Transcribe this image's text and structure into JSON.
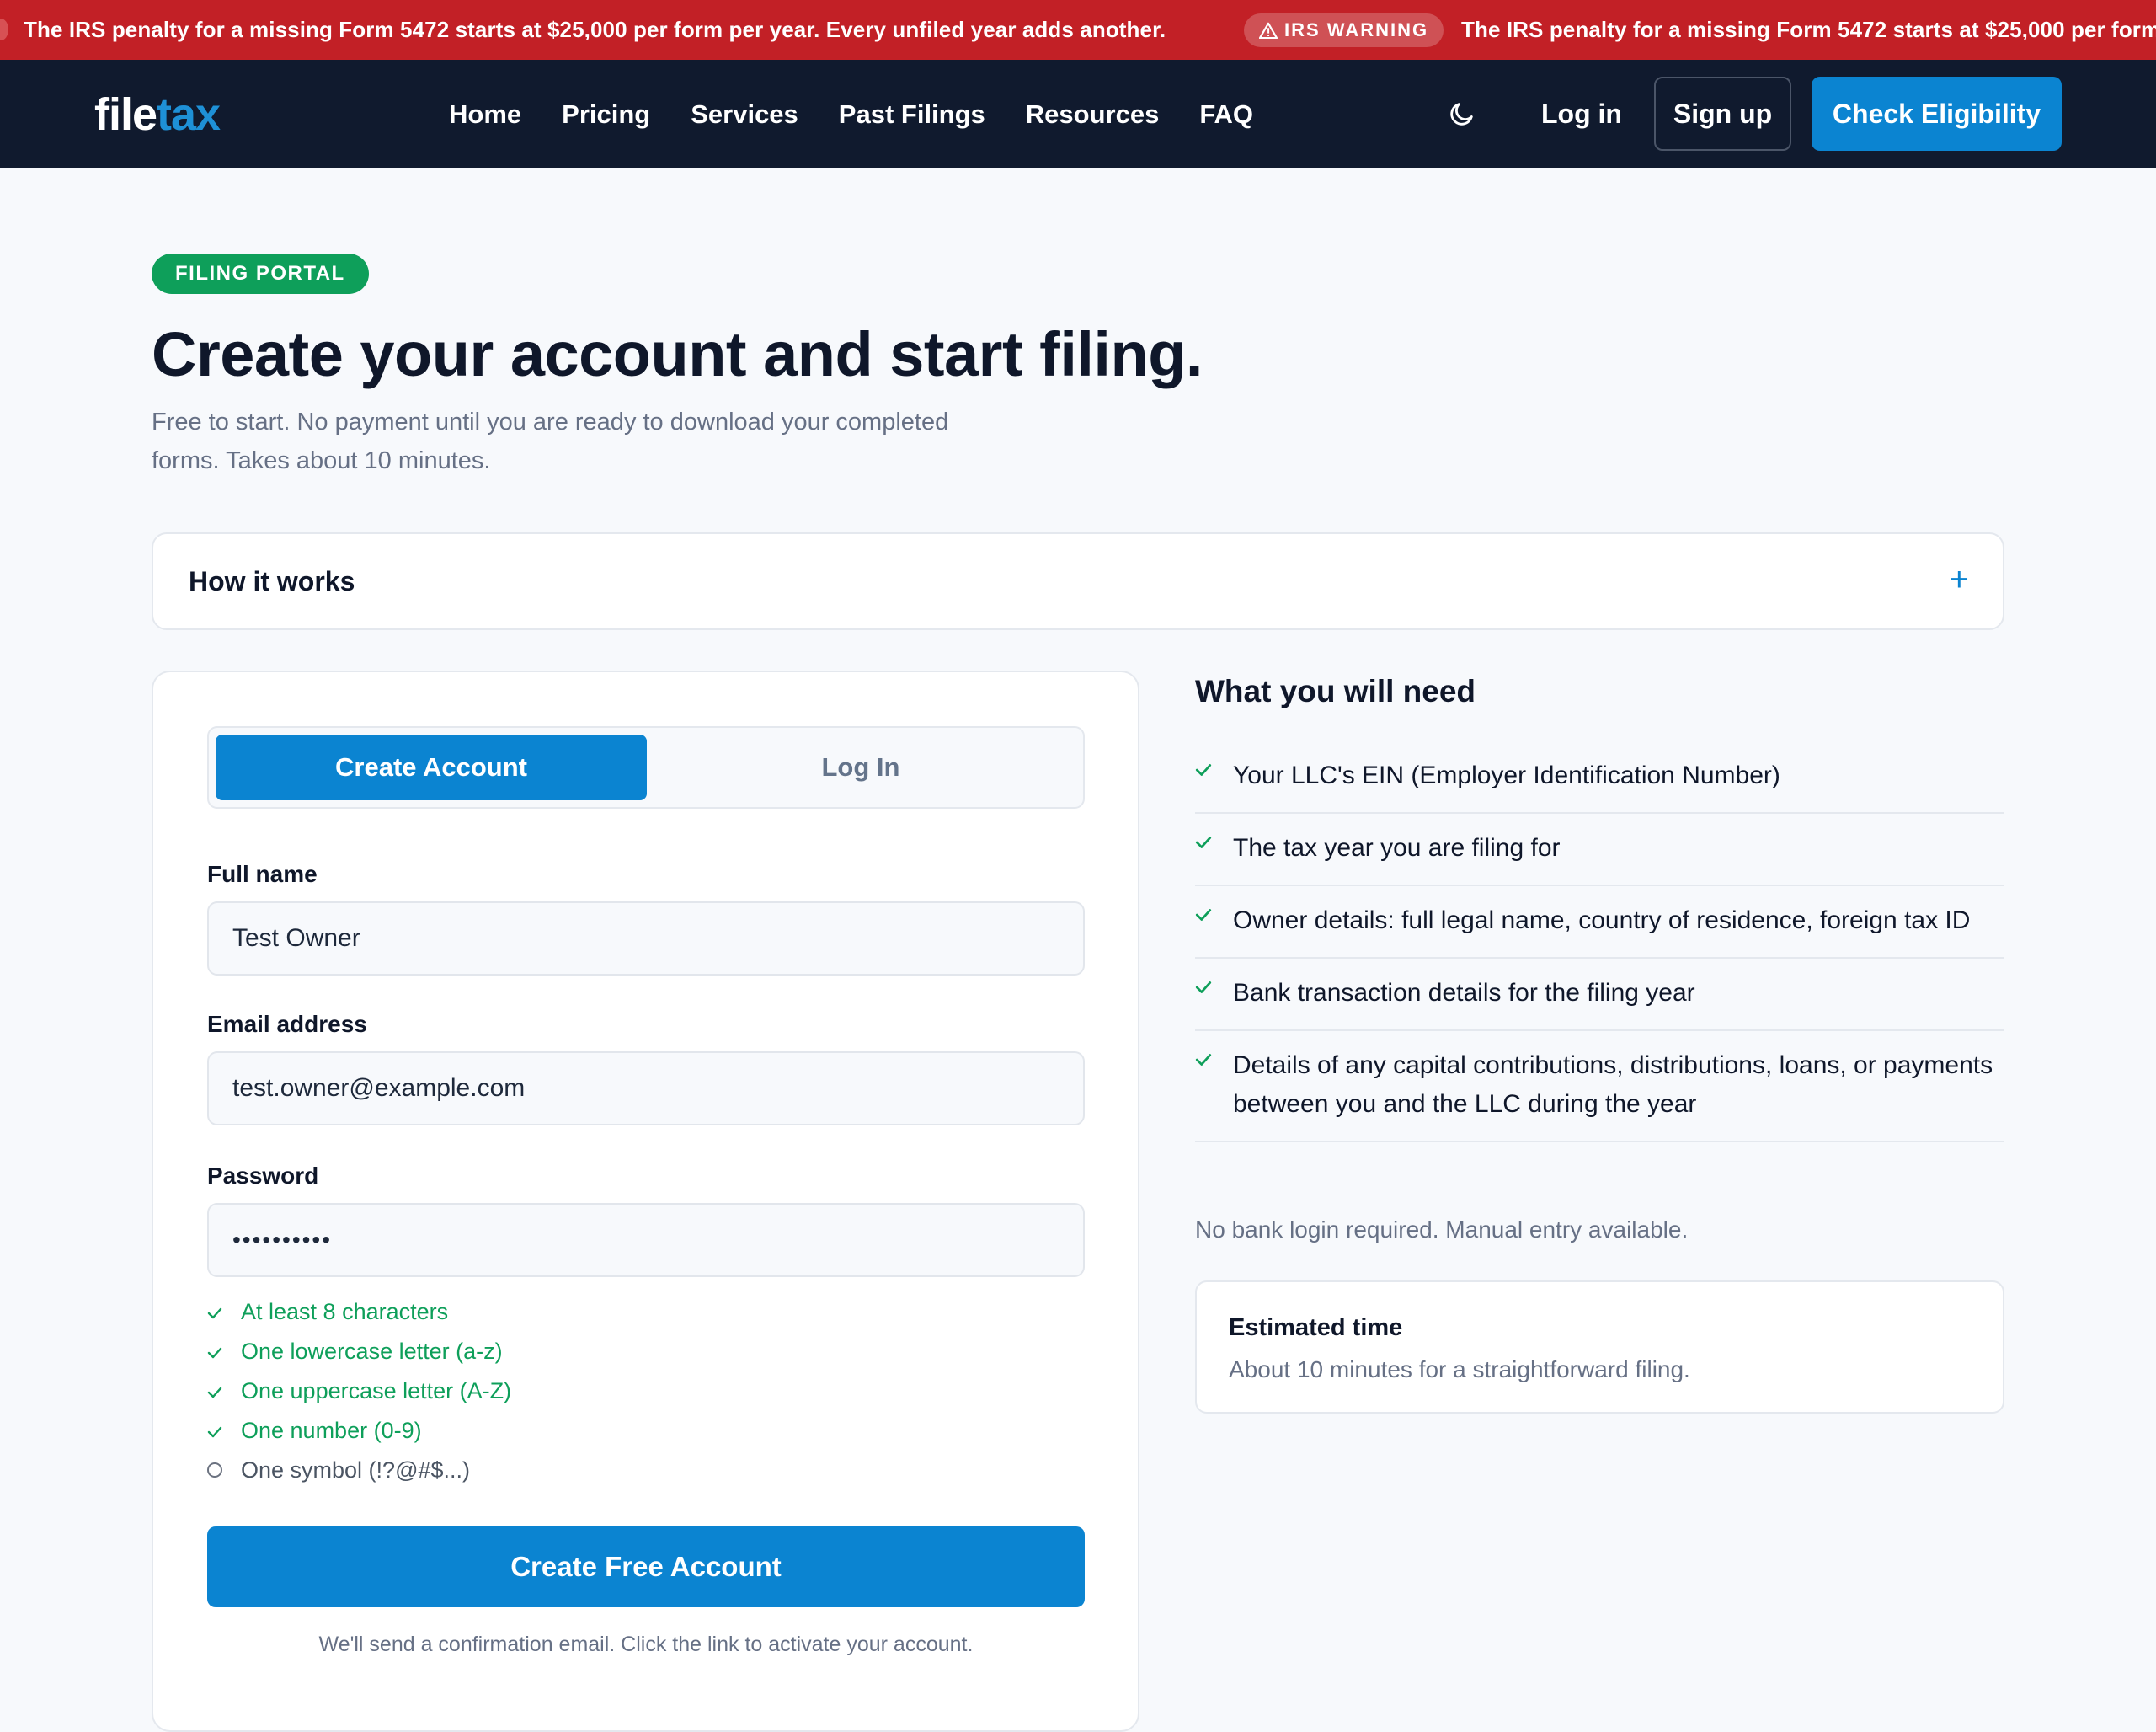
{
  "ticker": {
    "message": "The IRS penalty for a missing Form 5472 starts at $25,000 per form per year. Every unfiled year adds another.",
    "badge": "IRS WARNING",
    "message_repeat": "The IRS penalty for a missing Form 5472 starts at $25,000 per form"
  },
  "nav": {
    "logo_part1": "file",
    "logo_part2": "tax",
    "links": [
      "Home",
      "Pricing",
      "Services",
      "Past Filings",
      "Resources",
      "FAQ"
    ],
    "theme_icon": "moon-icon",
    "login": "Log in",
    "signup": "Sign up",
    "cta": "Check Eligibility"
  },
  "header": {
    "pill": "FILING PORTAL",
    "title": "Create your account and start filing.",
    "subtitle": "Free to start. No payment until you are ready to download your completed forms. Takes about 10 minutes."
  },
  "how_it_works": {
    "title": "How it works",
    "toggle_icon": "plus-icon"
  },
  "form": {
    "tabs": [
      "Create Account",
      "Log In"
    ],
    "active_tab": "Create Account",
    "full_name_label": "Full name",
    "full_name_value": "Test Owner",
    "email_label": "Email address",
    "email_value": "test.owner@example.com",
    "password_label": "Password",
    "password_value": "••••••••••",
    "rules": [
      {
        "text": "At least 8 characters",
        "met": true
      },
      {
        "text": "One lowercase letter (a-z)",
        "met": true
      },
      {
        "text": "One uppercase letter (A-Z)",
        "met": true
      },
      {
        "text": "One number (0-9)",
        "met": true
      },
      {
        "text": "One symbol (!?@#$...)",
        "met": false
      }
    ],
    "submit": "Create Free Account",
    "note": "We'll send a confirmation email. Click the link to activate your account."
  },
  "needs": {
    "title": "What you will need",
    "items": [
      "Your LLC's EIN (Employer Identification Number)",
      "The tax year you are filing for",
      "Owner details: full legal name, country of residence, foreign tax ID",
      "Bank transaction details for the filing year",
      "Details of any capital contributions, distributions, loans, or payments between you and the LLC during the year"
    ],
    "note": "No bank login required. Manual entry available.",
    "estimate_title": "Estimated time",
    "estimate_text": "About 10 minutes for a straightforward filing."
  },
  "colors": {
    "ticker_bg": "#c22026",
    "nav_bg": "#101a2e",
    "accent": "#0b84d1",
    "success": "#0e9f5a"
  }
}
